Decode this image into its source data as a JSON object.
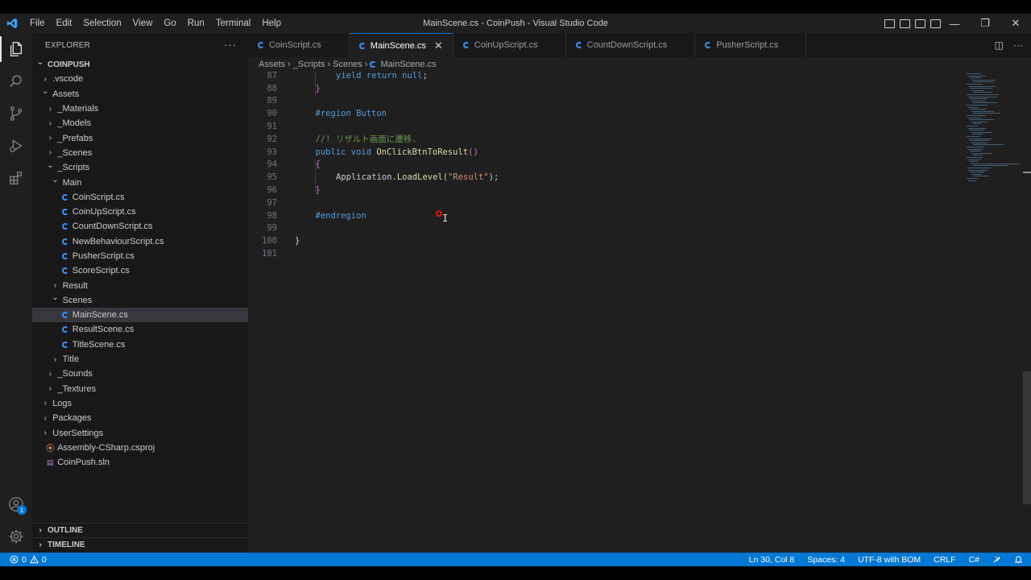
{
  "window": {
    "title": "MainScene.cs - CoinPush - Visual Studio Code"
  },
  "menu": [
    "File",
    "Edit",
    "Selection",
    "View",
    "Go",
    "Run",
    "Terminal",
    "Help"
  ],
  "activity_bar": {
    "icons": [
      "explorer-icon",
      "search-icon",
      "source-control-icon",
      "run-debug-icon",
      "extensions-icon"
    ],
    "bottom_icons": [
      "account-icon",
      "manage-gear-icon"
    ],
    "account_badge": "1"
  },
  "sidebar": {
    "header": "EXPLORER",
    "more": "···",
    "tree": [
      {
        "label": "COINPUSH",
        "depth": 0,
        "type": "folder-open",
        "bold": true
      },
      {
        "label": ".vscode",
        "depth": 1,
        "type": "folder"
      },
      {
        "label": "Assets",
        "depth": 1,
        "type": "folder-open"
      },
      {
        "label": "_Materials",
        "depth": 2,
        "type": "folder"
      },
      {
        "label": "_Models",
        "depth": 2,
        "type": "folder"
      },
      {
        "label": "_Prefabs",
        "depth": 2,
        "type": "folder"
      },
      {
        "label": "_Scenes",
        "depth": 2,
        "type": "folder"
      },
      {
        "label": "_Scripts",
        "depth": 2,
        "type": "folder-open"
      },
      {
        "label": "Main",
        "depth": 3,
        "type": "folder-open"
      },
      {
        "label": "CoinScript.cs",
        "depth": 4,
        "type": "cs"
      },
      {
        "label": "CoinUpScript.cs",
        "depth": 4,
        "type": "cs"
      },
      {
        "label": "CountDownScript.cs",
        "depth": 4,
        "type": "cs"
      },
      {
        "label": "NewBehaviourScript.cs",
        "depth": 4,
        "type": "cs"
      },
      {
        "label": "PusherScript.cs",
        "depth": 4,
        "type": "cs"
      },
      {
        "label": "ScoreScript.cs",
        "depth": 4,
        "type": "cs"
      },
      {
        "label": "Result",
        "depth": 3,
        "type": "folder"
      },
      {
        "label": "Scenes",
        "depth": 3,
        "type": "folder-open"
      },
      {
        "label": "MainScene.cs",
        "depth": 4,
        "type": "cs",
        "selected": true
      },
      {
        "label": "ResultScene.cs",
        "depth": 4,
        "type": "cs"
      },
      {
        "label": "TitleScene.cs",
        "depth": 4,
        "type": "cs"
      },
      {
        "label": "Title",
        "depth": 3,
        "type": "folder"
      },
      {
        "label": "_Sounds",
        "depth": 2,
        "type": "folder"
      },
      {
        "label": "_Textures",
        "depth": 2,
        "type": "folder"
      },
      {
        "label": "Logs",
        "depth": 1,
        "type": "folder"
      },
      {
        "label": "Packages",
        "depth": 1,
        "type": "folder"
      },
      {
        "label": "UserSettings",
        "depth": 1,
        "type": "folder"
      },
      {
        "label": "Assembly-CSharp.csproj",
        "depth": 1,
        "type": "rss"
      },
      {
        "label": "CoinPush.sln",
        "depth": 1,
        "type": "sln"
      }
    ],
    "outline": "OUTLINE",
    "timeline": "TIMELINE"
  },
  "tabs": [
    {
      "label": "CoinScript.cs",
      "active": false
    },
    {
      "label": "MainScene.cs",
      "active": true,
      "close": "✕"
    },
    {
      "label": "CoinUpScript.cs",
      "active": false
    },
    {
      "label": "CountDownScript.cs",
      "active": false
    },
    {
      "label": "PusherScript.cs",
      "active": false
    }
  ],
  "breadcrumb": [
    "Assets",
    "_Scripts",
    "Scenes",
    "MainScene.cs"
  ],
  "code_lines": [
    {
      "n": "87",
      "indent": 2,
      "tokens": [
        [
          "kw",
          "yield return null"
        ],
        [
          "pl",
          ";"
        ]
      ]
    },
    {
      "n": "88",
      "indent": 1,
      "tokens": [
        [
          "br",
          "}"
        ]
      ]
    },
    {
      "n": "89",
      "indent": 0,
      "tokens": []
    },
    {
      "n": "90",
      "indent": 1,
      "tokens": [
        [
          "kw",
          "#region Button"
        ]
      ]
    },
    {
      "n": "91",
      "indent": 0,
      "tokens": []
    },
    {
      "n": "92",
      "indent": 1,
      "tokens": [
        [
          "cm",
          "//! リザルト画面に遷移."
        ]
      ]
    },
    {
      "n": "93",
      "indent": 1,
      "tokens": [
        [
          "kw",
          "public void "
        ],
        [
          "fn",
          "OnClickBtnToResult"
        ],
        [
          "br",
          "()"
        ]
      ]
    },
    {
      "n": "94",
      "indent": 1,
      "tokens": [
        [
          "br",
          "{"
        ]
      ]
    },
    {
      "n": "95",
      "indent": 2,
      "tokens": [
        [
          "pl",
          "Application."
        ],
        [
          "fn",
          "LoadLevel"
        ],
        [
          "pl",
          "("
        ],
        [
          "str",
          "\"Result\""
        ],
        [
          "pl",
          ");"
        ]
      ]
    },
    {
      "n": "96",
      "indent": 1,
      "tokens": [
        [
          "br",
          "}"
        ]
      ]
    },
    {
      "n": "97",
      "indent": 0,
      "tokens": []
    },
    {
      "n": "98",
      "indent": 1,
      "tokens": [
        [
          "kw",
          "#endregion"
        ]
      ]
    },
    {
      "n": "99",
      "indent": 0,
      "tokens": []
    },
    {
      "n": "100",
      "indent": 0,
      "tokens": [
        [
          "fn",
          "}"
        ]
      ]
    },
    {
      "n": "101",
      "indent": 0,
      "tokens": []
    }
  ],
  "status": {
    "errors": "0",
    "warnings": "0",
    "position": "Ln 30, Col 8",
    "spaces": "Spaces: 4",
    "encoding": "UTF-8 with BOM",
    "eol": "CRLF",
    "language": "C#"
  },
  "colors": {
    "accent": "#0078d4",
    "keyword": "#569cd6",
    "function": "#dcdcaa",
    "string": "#ce9178",
    "comment": "#6a9955"
  }
}
